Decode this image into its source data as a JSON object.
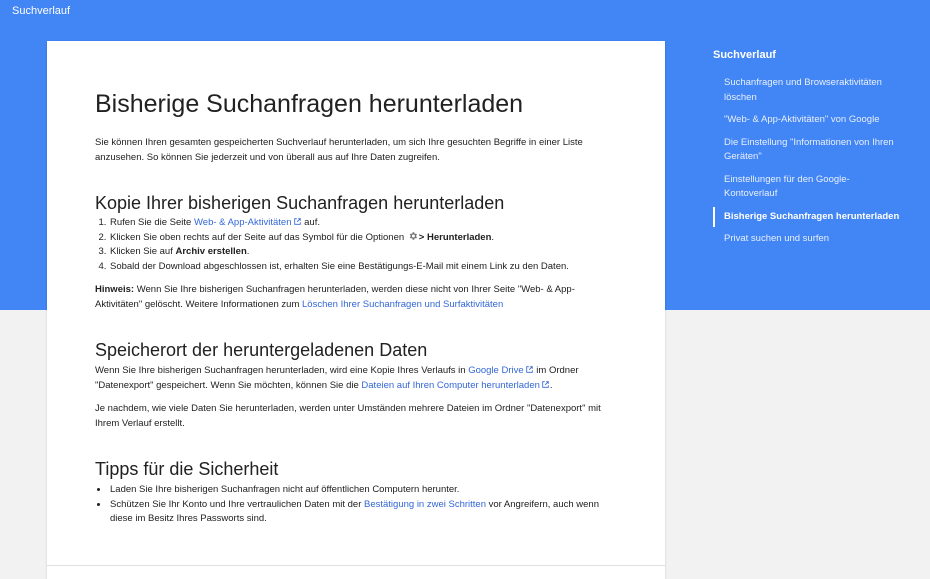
{
  "header": {
    "title": "Suchverlauf"
  },
  "article": {
    "title": "Bisherige Suchanfragen herunterladen",
    "intro": "Sie können Ihren gesamten gespeicherten Suchverlauf herunterladen, um sich Ihre gesuchten Begriffe in einer Liste anzusehen. So können Sie jederzeit und von überall aus auf Ihre Daten zugreifen.",
    "section1": {
      "heading": "Kopie Ihrer bisherigen Suchanfragen herunterladen",
      "step1": {
        "pre": "Rufen Sie die Seite ",
        "link": "Web- & App-Aktivitäten",
        "post": " auf."
      },
      "step2": {
        "pre": "Klicken Sie oben rechts auf der Seite auf das Symbol für die Optionen ",
        "bold": "> Herunterladen",
        "post": "."
      },
      "step3": {
        "pre": "Klicken Sie auf ",
        "bold": "Archiv erstellen",
        "post": "."
      },
      "step4": {
        "text": "Sobald der Download abgeschlossen ist, erhalten Sie eine Bestätigungs-E-Mail mit einem Link zu den Daten."
      },
      "note": {
        "label": "Hinweis:",
        "text": " Wenn Sie Ihre bisherigen Suchanfragen herunterladen, werden diese nicht von Ihrer Seite \"Web- & App-Aktivitäten\" gelöscht. Weitere Informationen zum ",
        "link": "Löschen Ihrer Suchanfragen und Surfaktivitäten"
      }
    },
    "section2": {
      "heading": "Speicherort der heruntergeladenen Daten",
      "p1": {
        "pre": "Wenn Sie Ihre bisherigen Suchanfragen herunterladen, wird eine Kopie Ihres Verlaufs in ",
        "link1": "Google Drive",
        "mid": " im Ordner \"Datenexport\" gespeichert. Wenn Sie möchten, können Sie die ",
        "link2": "Dateien auf Ihren Computer herunterladen",
        "post": "."
      },
      "p2": "Je nachdem, wie viele Daten Sie herunterladen, werden unter Umständen mehrere Dateien im Ordner \"Datenexport\" mit Ihrem Verlauf erstellt."
    },
    "section3": {
      "heading": "Tipps für die Sicherheit",
      "tip1": "Laden Sie Ihre bisherigen Suchanfragen nicht auf öffentlichen Computern herunter.",
      "tip2": {
        "pre": "Schützen Sie Ihr Konto und Ihre vertraulichen Daten mit der ",
        "link": "Bestätigung in zwei Schritten",
        "post": " vor Angreifern, auch wenn diese im Besitz Ihres Passworts sind."
      }
    }
  },
  "toc": {
    "title": "Suchverlauf",
    "items": [
      {
        "label": "Suchanfragen und Browseraktivitäten löschen"
      },
      {
        "label": "\"Web- & App-Aktivitäten\" von Google"
      },
      {
        "label": "Die Einstellung \"Informationen von Ihren Geräten\""
      },
      {
        "label": "Einstellungen für den Google-Kontoverlauf"
      },
      {
        "label": "Bisherige Suchanfragen herunterladen",
        "active": true
      },
      {
        "label": "Privat suchen und surfen"
      }
    ]
  },
  "colors": {
    "header_bg": "#4285f4",
    "link": "#3367d6",
    "page_bg": "#f2f2f2"
  }
}
